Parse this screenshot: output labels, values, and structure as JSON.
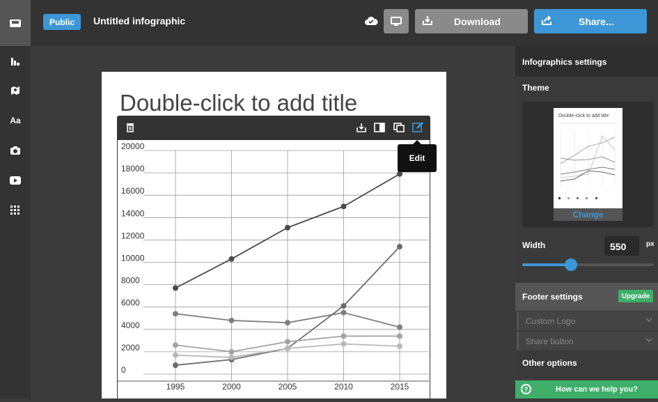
{
  "topbar": {
    "visibility_badge": "Public",
    "document_title": "Untitled infographic",
    "download_label": "Download",
    "share_label": "Share..."
  },
  "leftbar": {
    "items": [
      "chart-icon",
      "map-icon",
      "text-icon",
      "camera-icon",
      "video-icon",
      "grid-icon"
    ]
  },
  "canvas": {
    "title": "Double-click to add title"
  },
  "tooltip": {
    "edit_label": "Edit"
  },
  "chart_data": {
    "type": "line",
    "categories": [
      "1995",
      "2000",
      "2005",
      "2010",
      "2015"
    ],
    "ylim": [
      0,
      20000
    ],
    "yticks": [
      "20000",
      "18000",
      "16000",
      "14000",
      "12000",
      "10000",
      "8000",
      "6000",
      "4000",
      "2000",
      "0"
    ],
    "grid": true,
    "series": [
      {
        "values": [
          7700,
          10300,
          13100,
          15000,
          17900
        ],
        "color": "#4a4a4a"
      },
      {
        "values": [
          5400,
          4800,
          4600,
          5500,
          4200
        ],
        "color": "#7f7f7f"
      },
      {
        "values": [
          800,
          1300,
          2300,
          6100,
          11400
        ],
        "color": "#6b6b6b"
      },
      {
        "values": [
          2600,
          2000,
          2900,
          3400,
          3400
        ],
        "color": "#a3a3a3"
      },
      {
        "values": [
          1700,
          1500,
          2300,
          2700,
          2500
        ],
        "color": "#b8b8b8"
      }
    ]
  },
  "rightpanel": {
    "header": "Infographics settings",
    "theme_label": "Theme",
    "thumbnail_title": "Double-click to add title",
    "change_label": "Change",
    "width_label": "Width",
    "width_value": "550",
    "width_unit": "px",
    "width_slider_fraction": 0.37,
    "footer_label": "Footer settings",
    "upgrade_label": "Upgrade",
    "custom_logo_label": "Custom Logo",
    "share_button_label": "Share button",
    "other_options_label": "Other options"
  },
  "help": {
    "label": "How can we help you?"
  },
  "colors": {
    "accent": "#3d97d6",
    "success": "#3fae6a"
  }
}
